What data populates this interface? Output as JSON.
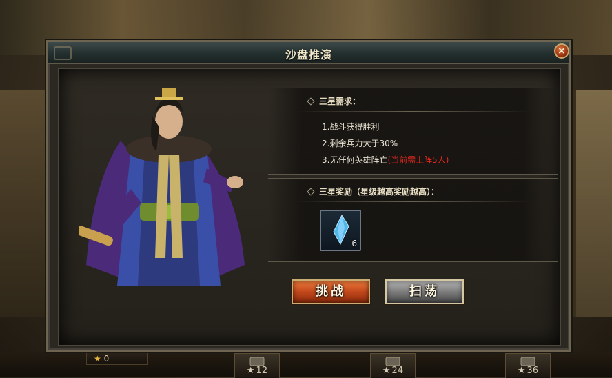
{
  "window": {
    "title": "沙盘推演",
    "close_label": "×"
  },
  "requirements": {
    "heading": "三星需求：",
    "items": [
      {
        "text": "1.战斗获得胜利",
        "note": ""
      },
      {
        "text": "2.剩余兵力大于30%",
        "note": ""
      },
      {
        "text": "3.无任何英雄阵亡",
        "note": "(当前需上阵5人)"
      }
    ]
  },
  "rewards": {
    "heading": "三星奖励（星级越高奖励越高）：",
    "items": [
      {
        "icon": "blue-crystal-icon",
        "quantity": "6"
      }
    ]
  },
  "actions": {
    "challenge_label": "挑战",
    "sweep_label": "扫荡"
  },
  "bottom_bar": {
    "star_count": "0",
    "slots": [
      {
        "label": "12"
      },
      {
        "label": "24"
      },
      {
        "label": "36"
      }
    ]
  },
  "colors": {
    "warning_text": "#e3261e",
    "challenge_button": "#c2481c",
    "sweep_button": "#7d7d7d",
    "crystal": "#4fb6e8"
  }
}
